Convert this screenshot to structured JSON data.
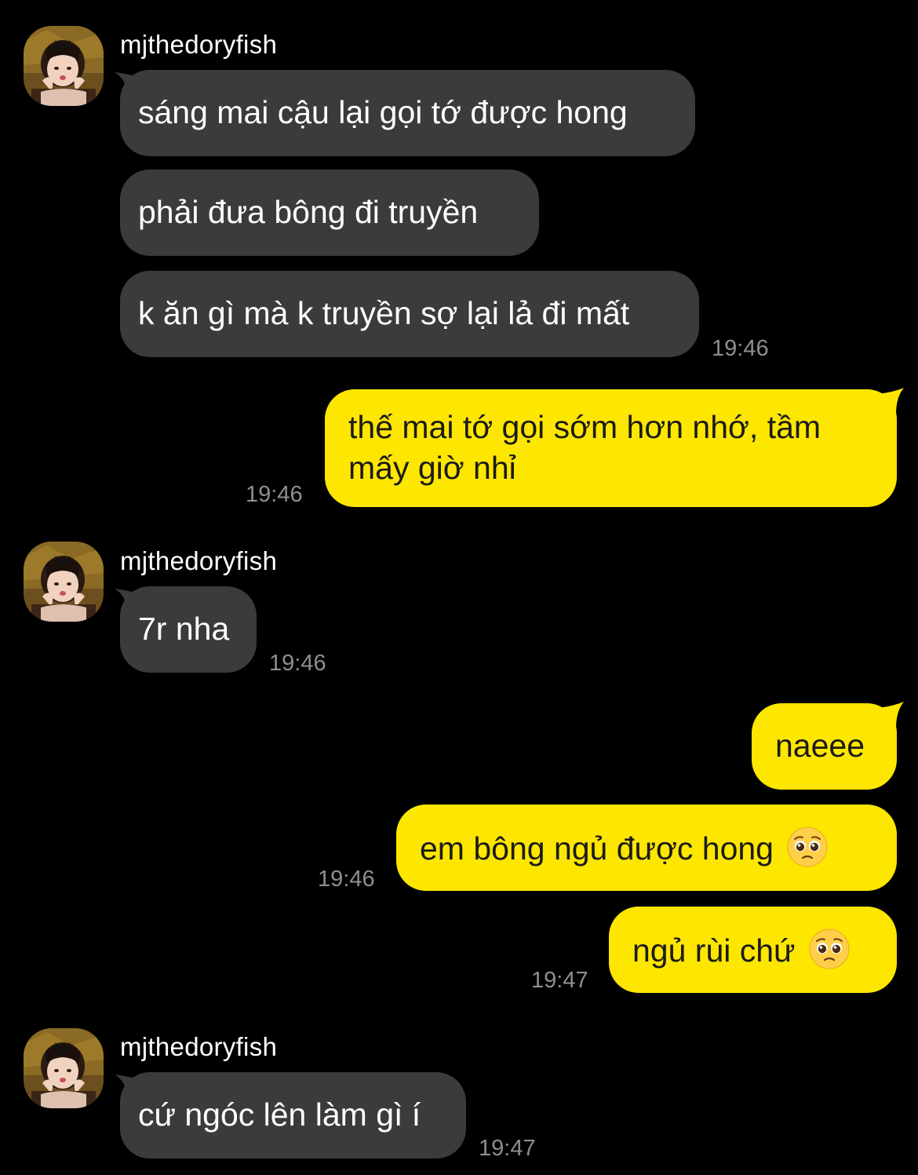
{
  "contact": {
    "name": "mjthedoryfish"
  },
  "messages": [
    {
      "id": "m1",
      "side": "in",
      "text": "sáng mai cậu lại gọi tớ được hong"
    },
    {
      "id": "m2",
      "side": "in",
      "text": "phải đưa bông đi truyền"
    },
    {
      "id": "m3",
      "side": "in",
      "text": "k ăn gì mà k truyền sợ lại lả đi mất",
      "time": "19:46"
    },
    {
      "id": "m4",
      "side": "out",
      "line1": "thế mai tớ gọi sớm hơn nhớ, tầm",
      "line2": "mấy giờ nhỉ",
      "time": "19:46"
    },
    {
      "id": "m5",
      "side": "in",
      "text": "7r nha",
      "time": "19:46"
    },
    {
      "id": "m6",
      "side": "out",
      "text": "naeee"
    },
    {
      "id": "m7",
      "side": "out",
      "text": "em bông ngủ được hong",
      "emoji": "pleading-face-icon",
      "time": "19:46"
    },
    {
      "id": "m8",
      "side": "out",
      "text": "ngủ rùi chứ",
      "emoji": "pleading-face-icon",
      "time": "19:47"
    },
    {
      "id": "m9",
      "side": "in",
      "text": "cứ ngóc lên làm gì í",
      "time": "19:47"
    }
  ],
  "colors": {
    "background": "#000000",
    "incoming_bubble": "#3b3b3d",
    "outgoing_bubble": "#fde600",
    "time_text": "#8e8e93"
  }
}
